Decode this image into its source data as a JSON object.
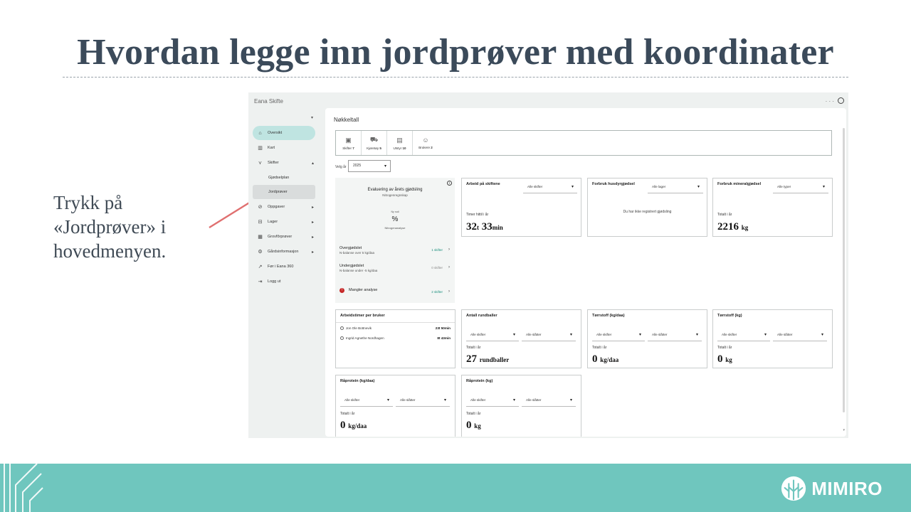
{
  "slide": {
    "title": "Hvordan legge inn jordprøver med koordinater",
    "instruction_lines": [
      "Trykk på",
      "«Jordprøver» i",
      "hovedmenyen."
    ],
    "logo_text": "MIMIRO"
  },
  "app": {
    "title": "Eana Skifte",
    "top_dots": "·  ·  ·",
    "nav": [
      {
        "label": "Oversikt",
        "icon": "home-icon"
      },
      {
        "label": "Kart",
        "icon": "map-icon"
      },
      {
        "label": "Skifter",
        "icon": "field-icon"
      },
      {
        "label": "Gjødselplan",
        "icon": ""
      },
      {
        "label": "Jordprøver",
        "icon": ""
      },
      {
        "label": "Oppgaver",
        "icon": "task-icon"
      },
      {
        "label": "Lager",
        "icon": "storage-icon"
      },
      {
        "label": "Grovfôrprøver",
        "icon": "feed-icon"
      },
      {
        "label": "Gårdsinformasjon",
        "icon": "gear-icon"
      },
      {
        "label": "Før i Eana 360",
        "icon": "external-icon"
      },
      {
        "label": "Logg ut",
        "icon": "logout-icon"
      }
    ],
    "main_title": "Nøkkeltall",
    "kpis": [
      {
        "label": "Skifter",
        "value": "7"
      },
      {
        "label": "Kjøretøy",
        "value": "5"
      },
      {
        "label": "Utstyr",
        "value": "10"
      },
      {
        "label": "Brukere",
        "value": "2"
      }
    ],
    "year_label": "Velg år",
    "year_value": "2025",
    "evaluation": {
      "title": "Evaluering av årets gjødsling",
      "subtitle": "Nitrogenregnskap",
      "gauge_caption": "Ny rudi",
      "gauge_value": "%",
      "gauge_label": "Nitrogenanalyse",
      "rows": [
        {
          "label": "Overgjødslet",
          "desc": "N-balanse over 5 kg/daa",
          "count": "1 skifter"
        },
        {
          "label": "Undergjødslet",
          "desc": "N-balanse under -5 kg/daa",
          "count": "0 skifter"
        },
        {
          "label": "Mangler analyse",
          "desc": "",
          "count": "2 skifter"
        }
      ]
    },
    "work_card": {
      "title": "Arbeid på skiftene",
      "select": "Alle skifter",
      "total_label": "Timer hittil i år",
      "hours": "32",
      "hours_unit": "t",
      "minutes": "33",
      "minutes_unit": "min"
    },
    "manure_card": {
      "title": "Forbruk husdyrgjødsel",
      "select": "Alle lager",
      "empty_text": "Du har ikke registrert gjødsling"
    },
    "mineral_card": {
      "title": "Forbruk mineralgjødsel",
      "select": "Alle typer",
      "total_label": "Totalt i år",
      "value": "2216",
      "unit": "kg"
    },
    "users_card": {
      "title": "Arbeidstimer per bruker",
      "users": [
        {
          "name": "Jon Ole Bottnevik",
          "hours": "23t 50min"
        },
        {
          "name": "Ingrid Agnethe Nordhagen",
          "hours": "8t 43min"
        }
      ]
    },
    "bales_card": {
      "title": "Antall rundballer",
      "select1": "Alle skifter",
      "select2": "Alle slåtter",
      "total_label": "Totalt i år",
      "value": "27",
      "unit": "rundballer"
    },
    "drymatter_card": {
      "title": "Tørrstoff (kg/daa)",
      "select1": "Alle skifter",
      "select2": "Alle slåtter",
      "total_label": "Totalt i år",
      "value": "0",
      "unit": "kg/daa"
    },
    "drymatter_kg_card": {
      "title": "Tørrstoff (kg)",
      "select1": "Alle skifter",
      "select2": "Alle slåtter",
      "total_label": "Totalt i år",
      "value": "0",
      "unit": "kg"
    },
    "protein_card": {
      "title": "Råprotein (kg/daa)",
      "select1": "Alle skifter",
      "select2": "Alle slåtter",
      "total_label": "Totalt i år",
      "value": "0",
      "unit": "kg/daa"
    },
    "protein_kg_card": {
      "title": "Råprotein (kg)",
      "select1": "Alle skifter",
      "select2": "Alle slåtter",
      "total_label": "Totalt i år",
      "value": "0",
      "unit": "kg"
    }
  },
  "colors": {
    "accent": "#6fc6be",
    "active_nav": "#bfe4e1",
    "arrow": "#e07070",
    "title": "#3b4a5a"
  }
}
